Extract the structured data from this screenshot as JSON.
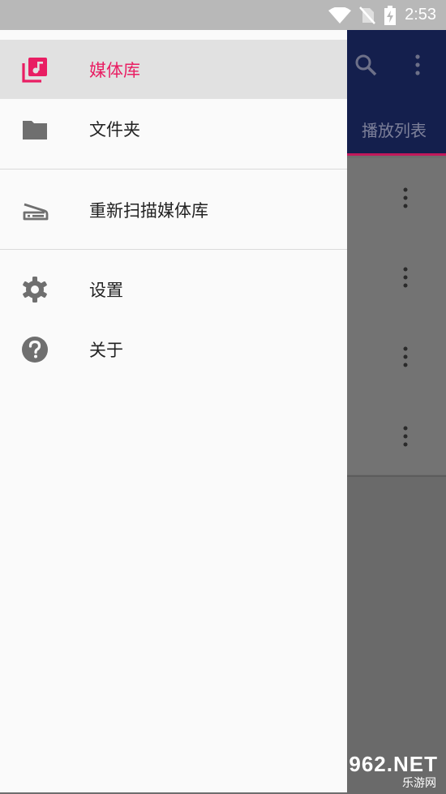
{
  "status_bar": {
    "time": "2:53"
  },
  "drawer": {
    "items": [
      {
        "label": "媒体库",
        "icon": "library-music-icon",
        "active": true
      },
      {
        "label": "文件夹",
        "icon": "folder-icon",
        "active": false
      },
      {
        "label": "重新扫描媒体库",
        "icon": "scanner-icon",
        "active": false
      },
      {
        "label": "设置",
        "icon": "gear-icon",
        "active": false
      },
      {
        "label": "关于",
        "icon": "help-icon",
        "active": false
      }
    ]
  },
  "background_app": {
    "tab_label": "播放列表",
    "toolbar_icons": [
      "search-icon",
      "more-vert-icon"
    ]
  },
  "colors": {
    "accent": "#e91e63",
    "toolbar": "#141f4d",
    "active_item_bg": "#e1e1e1"
  },
  "watermark": {
    "text": "962.NET",
    "sub": "乐游网"
  }
}
